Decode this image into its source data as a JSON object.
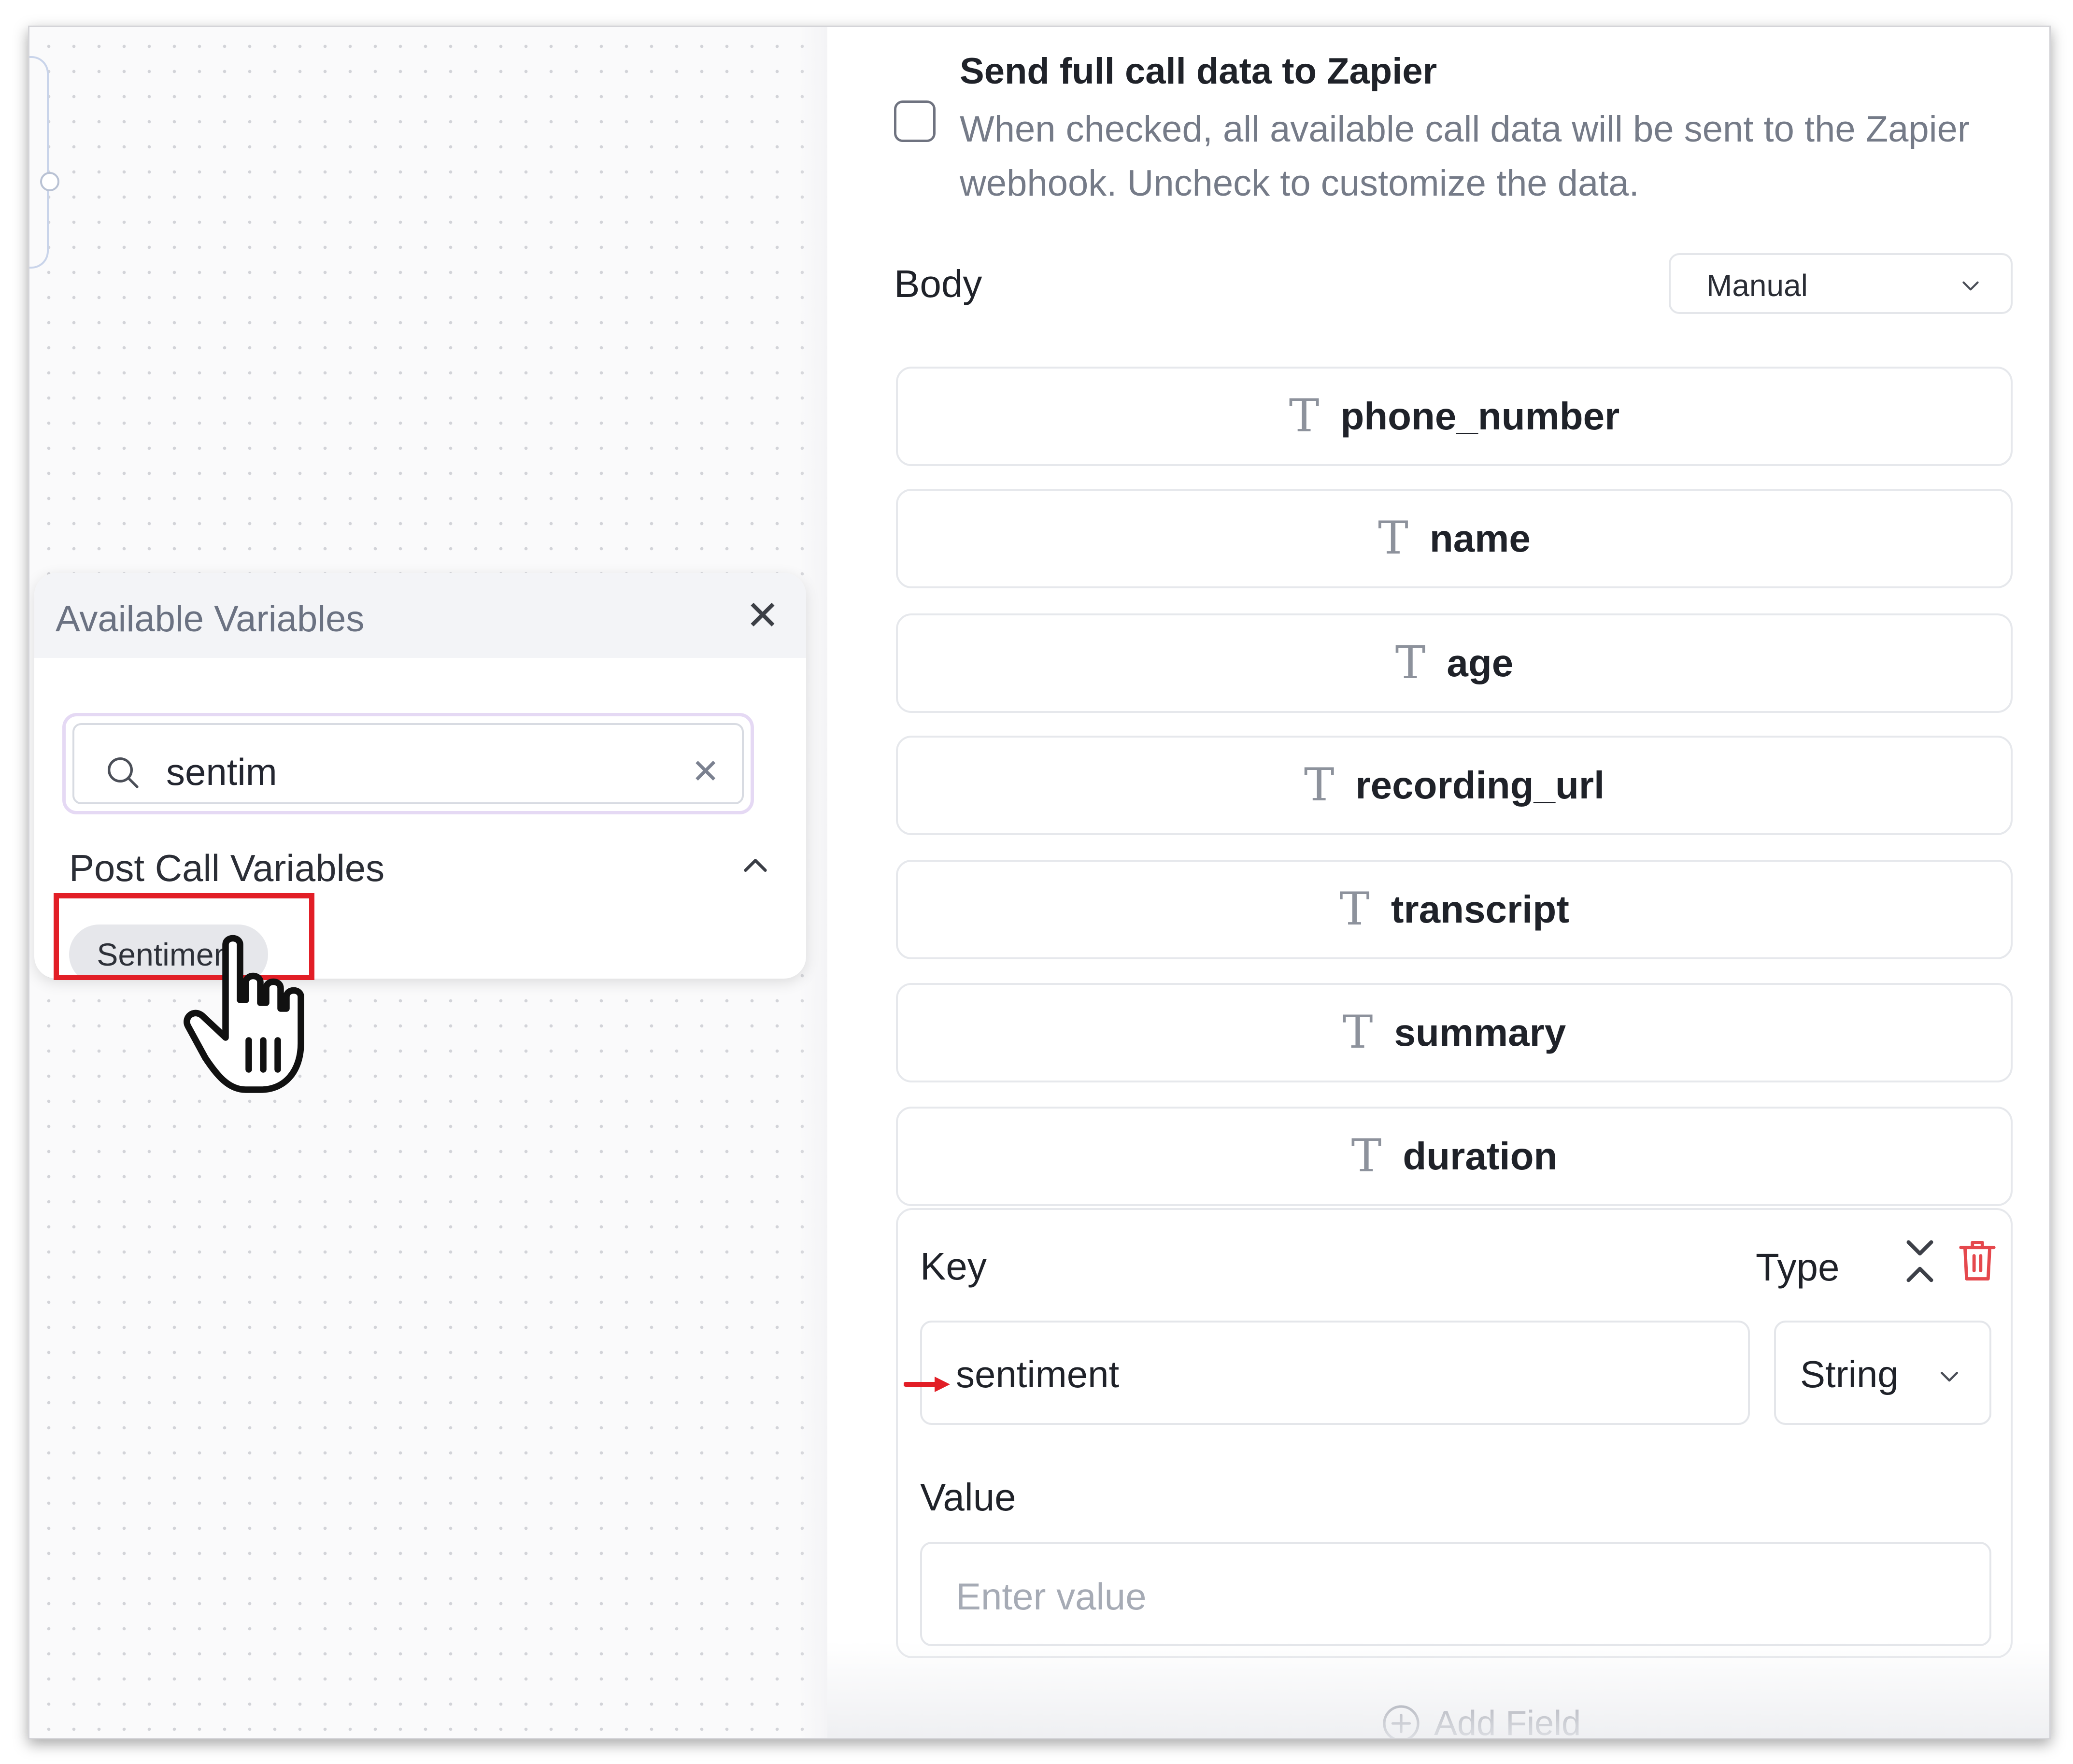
{
  "available_variables": {
    "title": "Available Variables",
    "search": {
      "value": "sentim",
      "placeholder": ""
    },
    "group": {
      "title": "Post Call Variables",
      "chips": [
        "Sentiment"
      ]
    }
  },
  "zapier": {
    "send_full_title": "Send full call data to Zapier",
    "send_full_desc": "When checked, all available call data will be sent to the Zapier webhook. Uncheck to customize the data.",
    "send_full_checked": false,
    "body_label": "Body",
    "body_mode": "Manual",
    "fields": [
      "phone_number",
      "name",
      "age",
      "recording_url",
      "transcript",
      "summary",
      "duration"
    ],
    "field_type_glyph": "T",
    "custom_field": {
      "key_label": "Key",
      "type_label": "Type",
      "key_value": "sentiment",
      "type_value": "String",
      "value_label": "Value",
      "value_placeholder": "Enter value"
    },
    "add_field_label": "Add Field"
  },
  "colors": {
    "highlight": "#e21e26",
    "delete_icon": "#e5484d",
    "search_focus_ring": "#e5d9f4"
  },
  "icons": [
    "search-icon",
    "close-icon",
    "chevron-up-icon",
    "chevron-down-icon",
    "text-type-icon",
    "reorder-icon",
    "trash-icon",
    "plus-circle-icon",
    "hand-pointer-icon",
    "arrow-right-icon"
  ]
}
